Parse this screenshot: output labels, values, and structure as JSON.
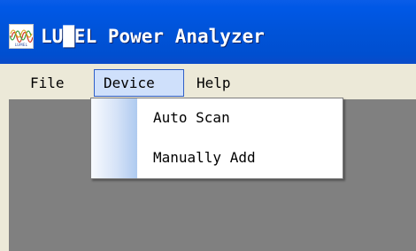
{
  "window": {
    "title": "LU█EL Power Analyzer",
    "icon": {
      "name": "lumel-logo-icon",
      "caption": "LUMEL"
    },
    "title_bar_color": "#0054e3"
  },
  "menubar": {
    "items": [
      {
        "label": "File",
        "open": false
      },
      {
        "label": "Device",
        "open": true
      },
      {
        "label": "Help",
        "open": false
      }
    ],
    "highlight_color": "#cfe0fb"
  },
  "dropdown": {
    "parent": "Device",
    "items": [
      {
        "label": "Auto Scan"
      },
      {
        "label": "Manually Add"
      }
    ]
  },
  "client_area": {
    "background": "#808080"
  }
}
